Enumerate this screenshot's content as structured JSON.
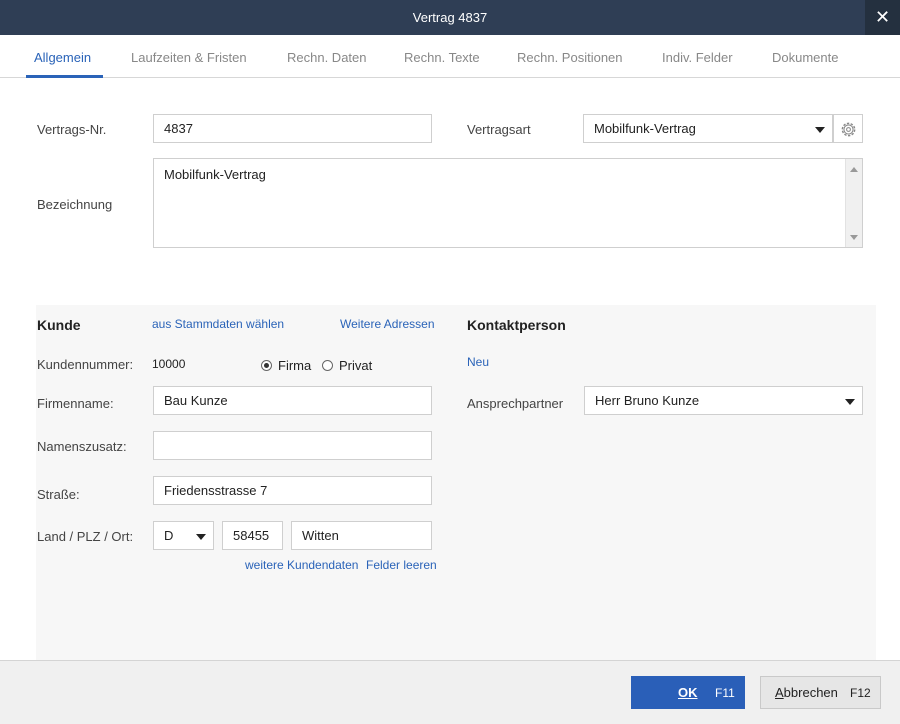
{
  "window": {
    "title": "Vertrag 4837",
    "close_glyph": "✕"
  },
  "tabs": [
    {
      "label": "Allgemein"
    },
    {
      "label": "Laufzeiten & Fristen"
    },
    {
      "label": "Rechn. Daten"
    },
    {
      "label": "Rechn. Texte"
    },
    {
      "label": "Rechn. Positionen"
    },
    {
      "label": "Indiv. Felder"
    },
    {
      "label": "Dokumente"
    }
  ],
  "active_tab": "Allgemein",
  "contract": {
    "nr_label": "Vertrags-Nr.",
    "nr_value": "4837",
    "type_label": "Vertragsart",
    "type_value": "Mobilfunk-Vertrag",
    "desc_label": "Bezeichnung",
    "desc_value": "Mobilfunk-Vertrag"
  },
  "customer": {
    "title": "Kunde",
    "link_master": "aus Stammdaten wählen",
    "link_addresses": "Weitere Adressen",
    "number_label": "Kundennummer:",
    "number_value": "10000",
    "radio_company": "Firma",
    "radio_private": "Privat",
    "selected_type": "Firma",
    "company_label": "Firmenname:",
    "company_value": "Bau Kunze",
    "suffix_label": "Namenszusatz:",
    "suffix_value": "",
    "street_label": "Straße:",
    "street_value": "Friedensstrasse 7",
    "location_label": "Land / PLZ / Ort:",
    "country_value": "D",
    "zip_value": "58455",
    "city_value": "Witten",
    "link_more": "weitere Kundendaten",
    "link_clear": "Felder leeren"
  },
  "contact": {
    "title": "Kontaktperson",
    "link_new": "Neu",
    "partner_label": "Ansprechpartner",
    "partner_value": "Herr Bruno Kunze"
  },
  "footer": {
    "ok_label": "OK",
    "ok_key": "F11",
    "cancel_label": "Abbrechen",
    "cancel_key": "F12"
  },
  "colors": {
    "titlebar": "#2f3e55",
    "accent": "#2a63b8",
    "ok_button": "#2a5fb8"
  },
  "icons": {
    "close": "close-icon",
    "gear": "gear-icon",
    "dropdown": "chevron-down-icon"
  }
}
